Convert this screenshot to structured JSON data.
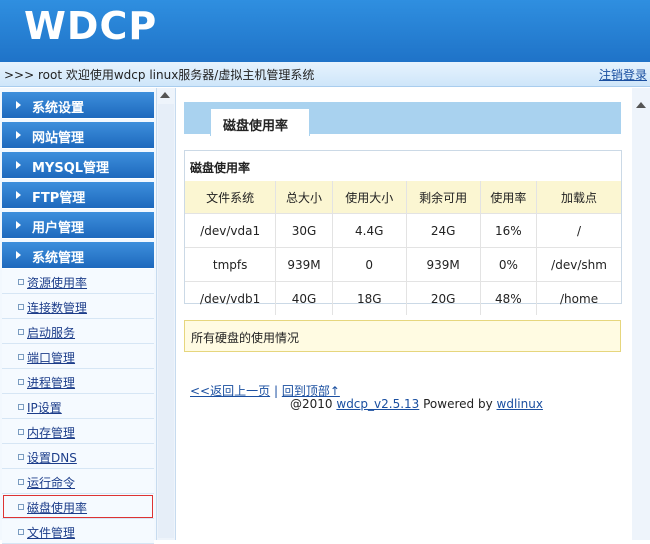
{
  "header": {
    "logo": "WDCP"
  },
  "topbar": {
    "welcome": ">>> root 欢迎使用wdcp linux服务器/虚拟主机管理系统",
    "logout": "注销登录"
  },
  "sidebar": {
    "sections": [
      "系统设置",
      "网站管理",
      "MYSQL管理",
      "FTP管理",
      "用户管理",
      "系统管理"
    ],
    "items": [
      "资源使用率",
      "连接数管理",
      "启动服务",
      "端口管理",
      "进程管理",
      "IP设置",
      "内存管理",
      "设置DNS",
      "运行命令",
      "磁盘使用率",
      "文件管理"
    ],
    "active_item": "磁盘使用率"
  },
  "main": {
    "tab_title": "磁盘使用率",
    "table_caption": "磁盘使用率",
    "columns": [
      "文件系统",
      "总大小",
      "使用大小",
      "剩余可用",
      "使用率",
      "加载点"
    ],
    "rows": [
      [
        "/dev/vda1",
        "30G",
        "4.4G",
        "24G",
        "16%",
        "/"
      ],
      [
        "tmpfs",
        "939M",
        "0",
        "939M",
        "0%",
        "/dev/shm"
      ],
      [
        "/dev/vdb1",
        "40G",
        "18G",
        "20G",
        "48%",
        "/home"
      ]
    ],
    "note": "所有硬盘的使用情况",
    "back_link": "<<返回上一页",
    "separator": "|",
    "top_link": "回到顶部↑",
    "footer_prefix": "@2010",
    "footer_version": "wdcp_v2.5.13",
    "footer_powered": "Powered by",
    "footer_brand": "wdlinux"
  }
}
